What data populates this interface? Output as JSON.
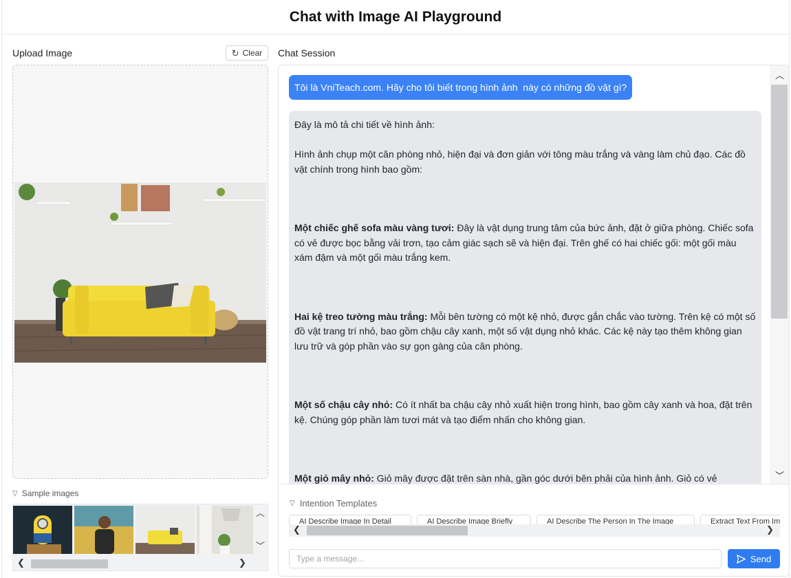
{
  "app": {
    "title": "Chat with Image AI Playground"
  },
  "upload": {
    "label": "Upload Image",
    "clear_label": "Clear",
    "clear_icon": "refresh-icon"
  },
  "samples": {
    "label": "Sample images",
    "icon": "chevron-down-icon"
  },
  "chat": {
    "label": "Chat Session",
    "user_message": "Tôi là VniTeach.com. Hãy cho tôi biết trong hình ảnh  này có những đồ vật gì?",
    "bot": {
      "intro": "Đây là mô tả chi tiết về hình ảnh:",
      "overview": "Hình ảnh chụp một căn phòng nhỏ, hiện đại và đơn giản với tông màu trắng và vàng làm chủ đạo. Các đồ vật chính trong hình bao gồm:",
      "items": [
        {
          "title": "Một chiếc ghế sofa màu vàng tươi:",
          "text": " Đây là vật dụng trung tâm của bức ảnh, đặt ở giữa phòng. Chiếc sofa có vẻ được bọc bằng vải trơn, tạo cảm giác sạch sẽ và hiện đại.  Trên ghế có hai chiếc gối: một gối màu xám đậm và một gối màu trắng kem."
        },
        {
          "title": "Hai kệ treo tường màu trắng:",
          "text": " Mỗi bên tường có một kệ nhỏ, được gắn chắc vào tường. Trên kệ có một số đồ vật trang trí nhỏ, bao gồm chậu cây xanh, một số vật dụng nhỏ khác. Các kệ này tạo thêm không gian lưu trữ và góp phần vào sự gọn gàng của căn phòng."
        },
        {
          "title": "Một số chậu cây nhỏ:",
          "text": " Có ít nhất ba chậu cây nhỏ xuất hiện trong hình, bao gồm cây xanh và hoa, đặt trên kệ. Chúng góp phần làm tươi mát và tạo điểm nhấn cho không gian."
        },
        {
          "title": "Một giỏ mây nhỏ:",
          "text": " Giỏ mây được đặt trên sàn nhà, gần góc dưới bên phải của hình ảnh. Giỏ có vẻ"
        }
      ]
    }
  },
  "templates": {
    "label": "Intention Templates",
    "buttons": [
      "AI Describe Image In Detail",
      "AI Describe Image Briefly",
      "AI Describe The Person In The Image",
      "Extract Text From Image"
    ]
  },
  "composer": {
    "placeholder": "Type a message...",
    "send_label": "Send"
  },
  "colors": {
    "accent": "#3b82f6",
    "send": "#2f7cf0",
    "bot_bubble": "#e6e8ec",
    "sofa": "#f2dc3a"
  }
}
